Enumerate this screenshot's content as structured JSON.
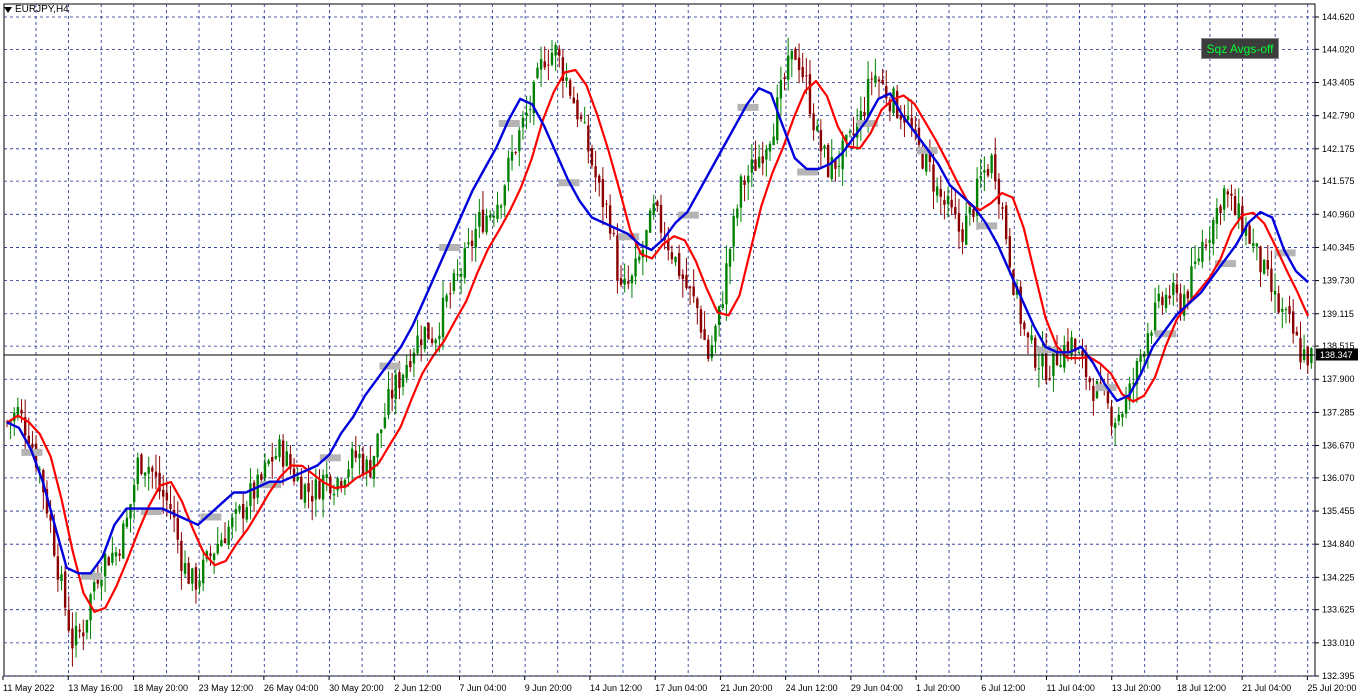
{
  "window": {
    "title": "EURJPY,H4"
  },
  "button": {
    "label": "Sqz Avgs-off"
  },
  "chart_data": {
    "type": "candlestick",
    "symbol": "EURJPY",
    "timeframe": "H4",
    "current_price": "138.347",
    "ylim": [
      132.395,
      144.62
    ],
    "y_ticks": [
      "144.620",
      "144.020",
      "143.405",
      "142.790",
      "142.175",
      "141.575",
      "140.960",
      "140.345",
      "139.730",
      "139.115",
      "138.515",
      "137.900",
      "137.285",
      "136.670",
      "136.070",
      "135.455",
      "134.840",
      "134.225",
      "133.625",
      "133.010",
      "132.395"
    ],
    "x_ticks": [
      "11 May 2022",
      "13 May 16:00",
      "18 May 20:00",
      "23 May 12:00",
      "26 May 04:00",
      "30 May 20:00",
      "2 Jun 12:00",
      "7 Jun 04:00",
      "9 Jun 20:00",
      "14 Jun 12:00",
      "17 Jun 04:00",
      "21 Jun 20:00",
      "24 Jun 12:00",
      "29 Jun 04:00",
      "1 Jul 20:00",
      "6 Jul 12:00",
      "11 Jul 04:00",
      "13 Jul 20:00",
      "18 Jul 12:00",
      "21 Jul 04:00",
      "25 Jul 20:00"
    ],
    "close_path": [
      137.1,
      137.3,
      136.9,
      136.2,
      135.2,
      134.0,
      133.0,
      133.3,
      134.2,
      134.6,
      134.7,
      135.3,
      136.4,
      136.3,
      135.8,
      135.5,
      134.5,
      134.1,
      134.4,
      134.8,
      135.1,
      135.3,
      135.7,
      135.9,
      136.4,
      136.6,
      136.2,
      135.9,
      135.8,
      136.1,
      136.0,
      136.3,
      136.5,
      136.2,
      136.9,
      137.6,
      138.0,
      138.5,
      138.8,
      138.7,
      139.3,
      139.7,
      140.2,
      140.8,
      141.0,
      141.3,
      142.0,
      142.6,
      143.1,
      143.9,
      144.0,
      143.5,
      142.9,
      142.2,
      141.4,
      140.9,
      139.5,
      139.7,
      140.3,
      141.0,
      140.6,
      140.1,
      139.6,
      139.2,
      138.3,
      139.1,
      140.4,
      141.5,
      141.8,
      142.2,
      142.7,
      143.5,
      144.0,
      143.3,
      142.3,
      141.8,
      142.0,
      142.3,
      142.8,
      143.6,
      143.3,
      143.0,
      142.8,
      142.2,
      141.9,
      141.3,
      141.0,
      140.6,
      141.0,
      141.7,
      142.0,
      140.8,
      139.5,
      138.6,
      138.3,
      138.1,
      138.4,
      138.6,
      138.2,
      137.8,
      137.5,
      137.2,
      137.4,
      138.0,
      138.8,
      139.2,
      139.5,
      139.3,
      139.7,
      140.4,
      140.8,
      141.4,
      141.0,
      140.7,
      140.2,
      139.7,
      139.2,
      138.9,
      138.4,
      138.3
    ],
    "ma_blue_path": [
      137.1,
      137.0,
      136.6,
      136.0,
      135.2,
      134.4,
      134.3,
      134.3,
      134.6,
      135.2,
      135.5,
      135.5,
      135.5,
      135.5,
      135.4,
      135.3,
      135.2,
      135.4,
      135.6,
      135.8,
      135.8,
      135.9,
      136.0,
      136.0,
      136.1,
      136.2,
      136.3,
      136.5,
      136.9,
      137.2,
      137.6,
      137.9,
      138.2,
      138.5,
      138.9,
      139.4,
      139.9,
      140.4,
      140.9,
      141.4,
      141.8,
      142.2,
      142.7,
      143.1,
      143.0,
      142.6,
      142.1,
      141.6,
      141.2,
      140.9,
      140.8,
      140.7,
      140.6,
      140.4,
      140.3,
      140.5,
      140.8,
      141.0,
      141.4,
      141.8,
      142.2,
      142.6,
      143.0,
      143.3,
      143.2,
      142.6,
      142.0,
      141.8,
      141.8,
      141.9,
      142.1,
      142.4,
      142.7,
      143.1,
      143.2,
      142.8,
      142.5,
      142.2,
      141.9,
      141.5,
      141.3,
      141.1,
      140.8,
      140.4,
      139.9,
      139.4,
      138.9,
      138.5,
      138.4,
      138.4,
      138.5,
      138.2,
      137.8,
      137.5,
      137.6,
      138.0,
      138.5,
      138.8,
      139.1,
      139.3,
      139.5,
      139.8,
      140.1,
      140.4,
      140.8,
      141.0,
      140.9,
      140.3,
      139.9,
      139.7
    ]
  }
}
